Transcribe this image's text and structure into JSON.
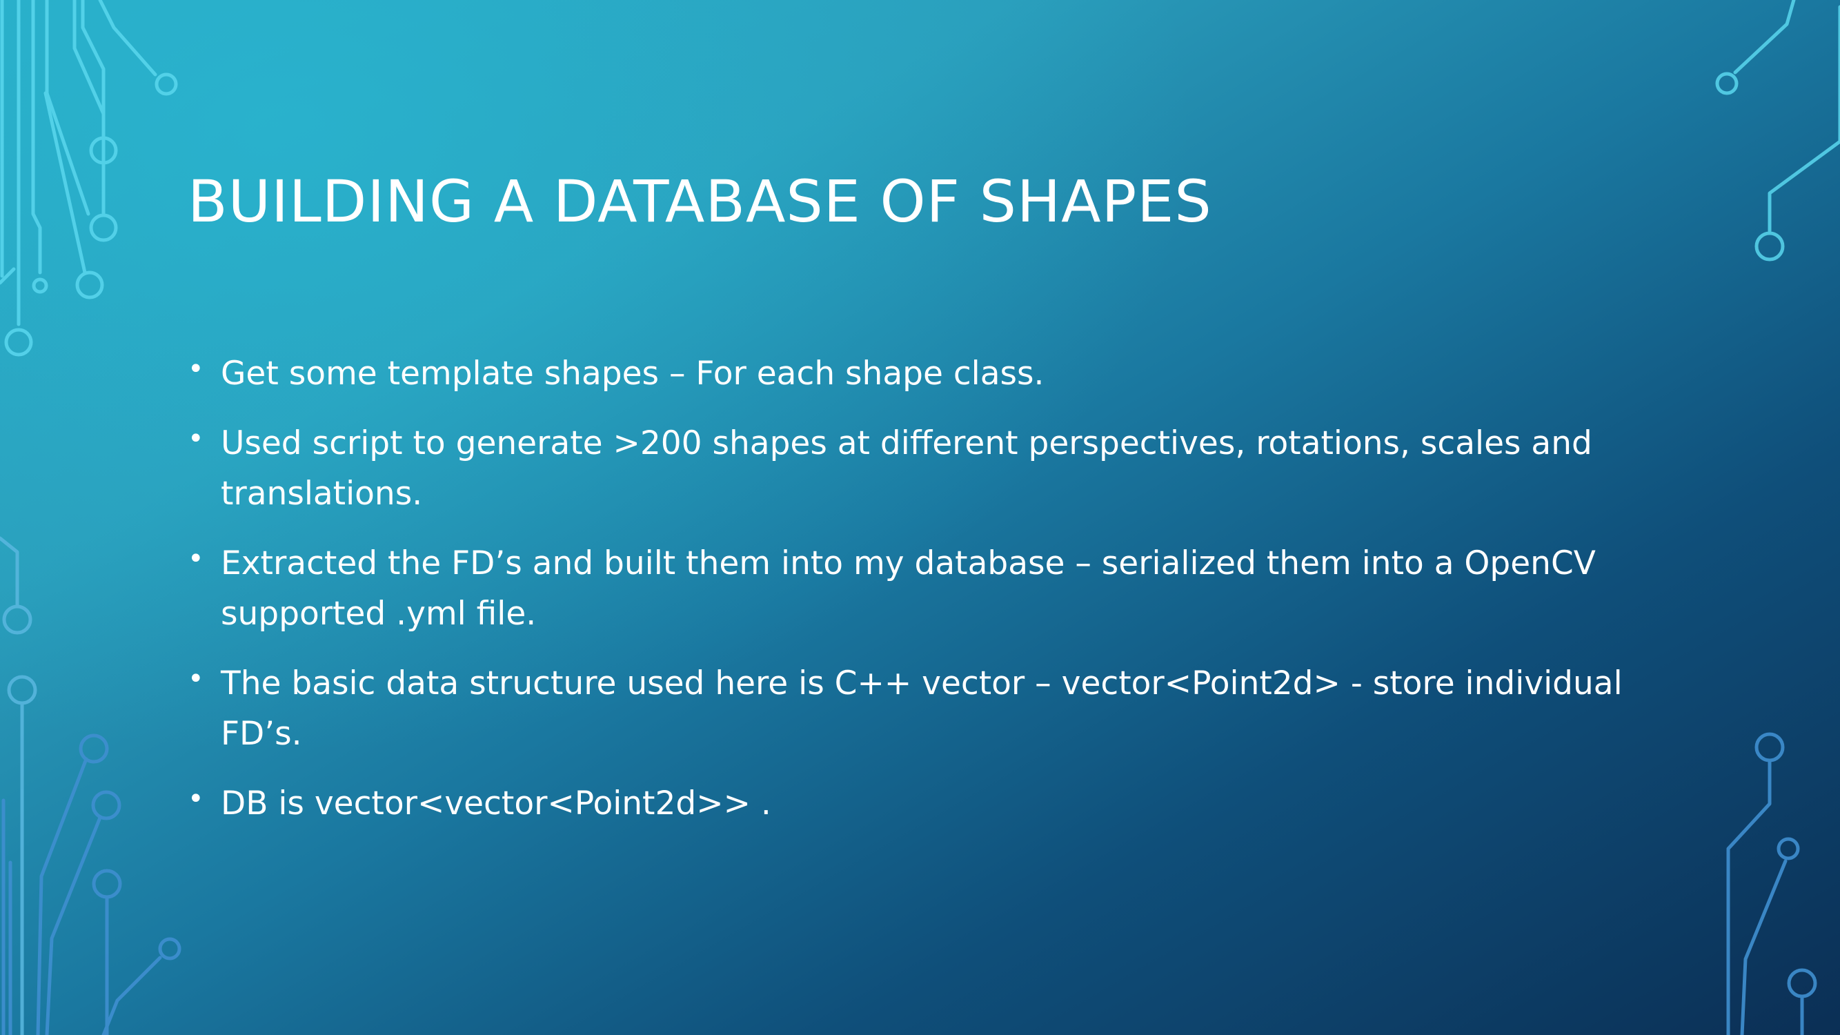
{
  "slide": {
    "title": "BUILDING A DATABASE OF SHAPES",
    "bullet_glyph": "•",
    "bullets": [
      "Get some template shapes – For each shape class.",
      "Used script to generate >200 shapes at different perspectives, rotations, scales and translations.",
      "Extracted the FD’s and built them into my database – serialized them into a OpenCV supported .yml file.",
      "The basic data structure used here is C++ vector – vector<Point2d> - store individual FD’s.",
      "DB is vector<vector<Point2d>> ."
    ]
  },
  "colors": {
    "background_top": "#2aa8c4",
    "background_bottom": "#0b2f55",
    "text": "#ffffff",
    "circuit_light": "#5ad7ee",
    "circuit_dark": "#3f8fd0"
  },
  "decorations": [
    "circuit-trace-graphic-left",
    "circuit-trace-graphic-right"
  ]
}
